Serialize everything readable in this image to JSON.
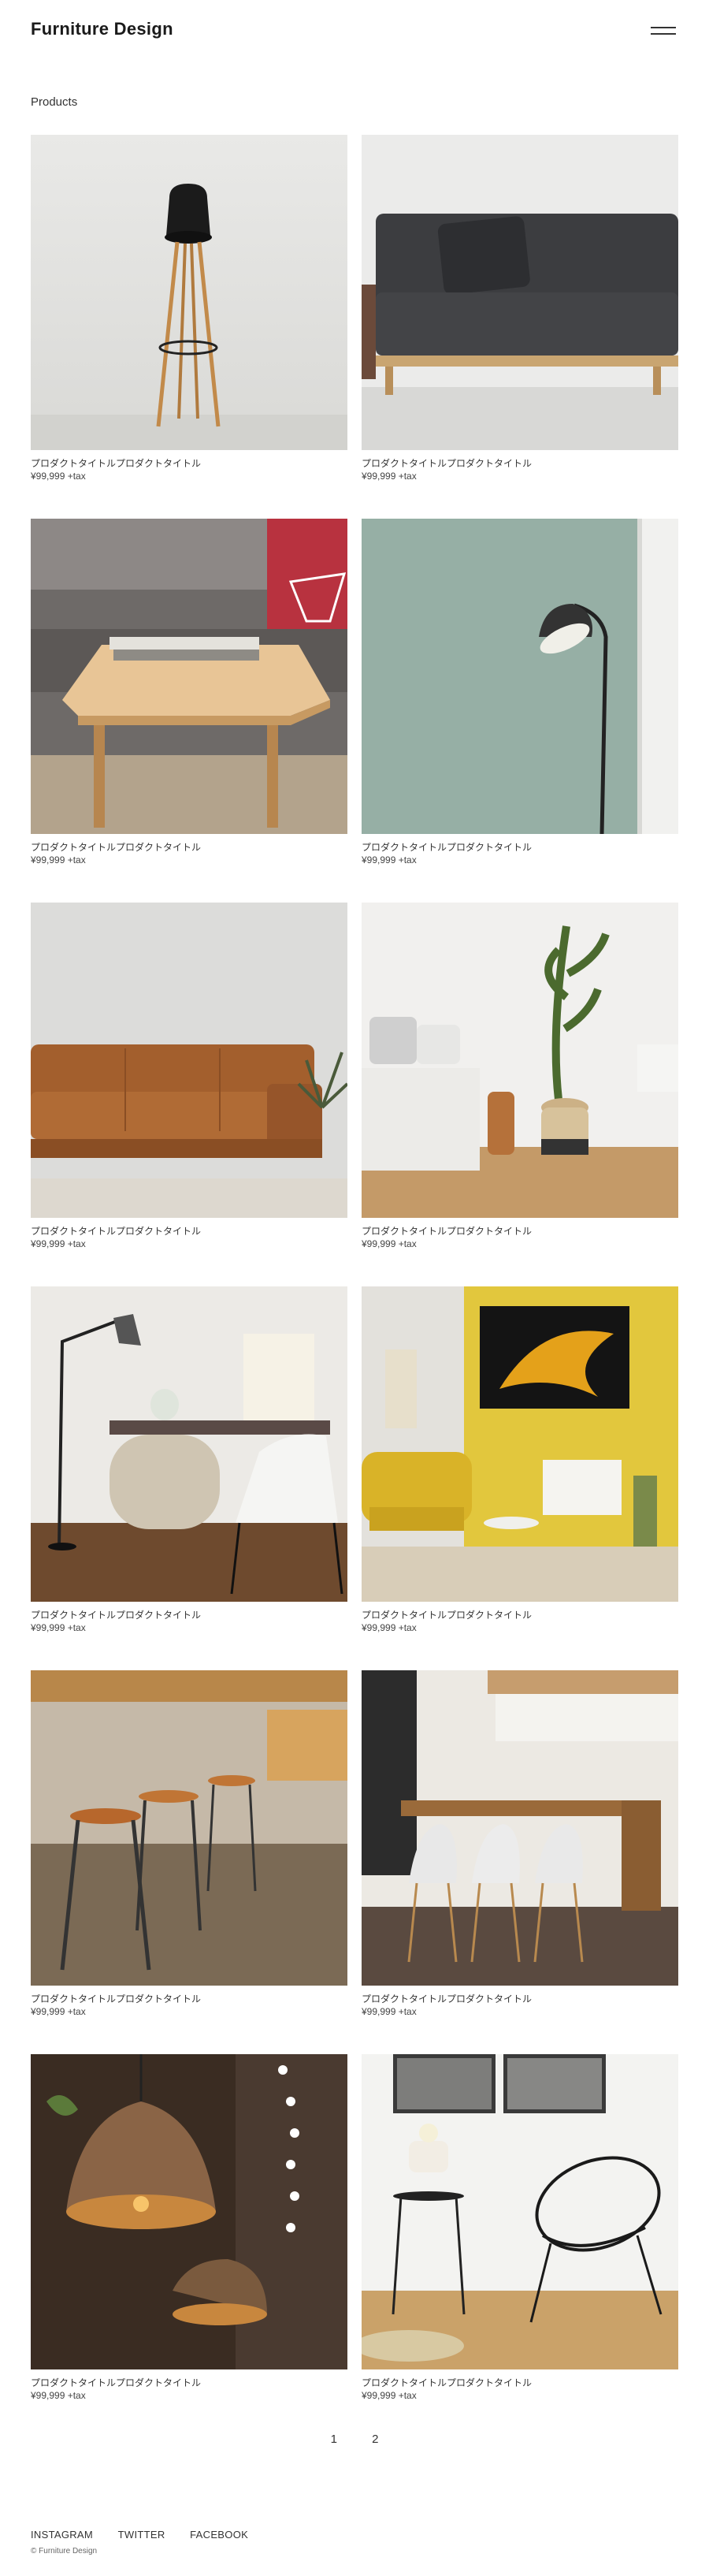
{
  "header": {
    "site_title": "Furniture Design",
    "menu_icon": "hamburger-icon"
  },
  "section": {
    "title": "Products"
  },
  "products": [
    {
      "title": "プロダクトタイトルプロダクトタイトル",
      "price": "¥99,999 +tax"
    },
    {
      "title": "プロダクトタイトルプロダクトタイトル",
      "price": "¥99,999 +tax"
    },
    {
      "title": "プロダクトタイトルプロダクトタイトル",
      "price": "¥99,999 +tax"
    },
    {
      "title": "プロダクトタイトルプロダクトタイトル",
      "price": "¥99,999 +tax"
    },
    {
      "title": "プロダクトタイトルプロダクトタイトル",
      "price": "¥99,999 +tax"
    },
    {
      "title": "プロダクトタイトルプロダクトタイトル",
      "price": "¥99,999 +tax"
    },
    {
      "title": "プロダクトタイトルプロダクトタイトル",
      "price": "¥99,999 +tax"
    },
    {
      "title": "プロダクトタイトルプロダクトタイトル",
      "price": "¥99,999 +tax"
    },
    {
      "title": "プロダクトタイトルプロダクトタイトル",
      "price": "¥99,999 +tax"
    },
    {
      "title": "プロダクトタイトルプロダクトタイトル",
      "price": "¥99,999 +tax"
    },
    {
      "title": "プロダクトタイトルプロダクトタイトル",
      "price": "¥99,999 +tax"
    },
    {
      "title": "プロダクトタイトルプロダクトタイトル",
      "price": "¥99,999 +tax"
    }
  ],
  "pagination": {
    "pages": [
      "1",
      "2"
    ]
  },
  "footer": {
    "social": [
      "INSTAGRAM",
      "TWITTER",
      "FACEBOOK"
    ],
    "copyright": "© Furniture Design"
  }
}
